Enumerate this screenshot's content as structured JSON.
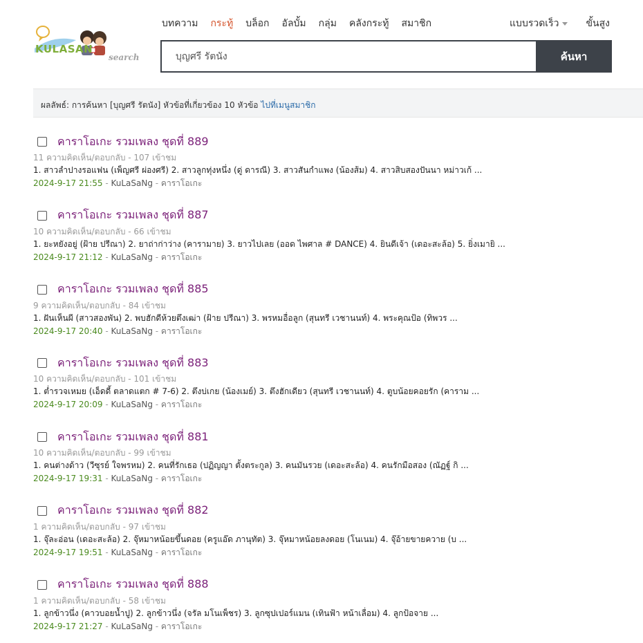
{
  "logo": {
    "wordmark": "KULASAN",
    "suffix": "search"
  },
  "nav": {
    "items": [
      {
        "label": "บทความ",
        "active": false
      },
      {
        "label": "กระทู้",
        "active": true
      },
      {
        "label": "บล็อก",
        "active": false
      },
      {
        "label": "อัลบั้ม",
        "active": false
      },
      {
        "label": "กลุ่ม",
        "active": false
      },
      {
        "label": "คลังกระทู้",
        "active": false
      },
      {
        "label": "สมาชิก",
        "active": false
      }
    ],
    "quick_label": "แบบรวดเร็ว",
    "advanced_label": "ขั้นสูง"
  },
  "search": {
    "value": "บุญศรี รัตนัง",
    "button_label": "ค้นหา"
  },
  "result_summary": {
    "text": "ผลลัพธ์: การค้นหา [บุญศรี รัตนัง] หัวข้อที่เกี่ยวข้อง 10 หัวข้อ",
    "link": "ไปที่เมนูสมาชิก"
  },
  "results": [
    {
      "title": "คาราโอเกะ รวมเพลง ชุดที่ 889",
      "meta": "11 ความคิดเห็น/ตอบกลับ - 107 เข้าชม",
      "snippet": "1. สาวลำปางรอแฟน (เพ็ญศรี ผ่องศรี) 2. สาวลูกทุ่งหนึ่ง (ดู่ ดารณี) 3. สาวสันกำแพง (น้องส้ม) 4. สาวสิบสองปันนา หม่าวเก้ ...",
      "date": "2024-9-17 21:55",
      "author": "KuLaSaNg",
      "category": "คาราโอเกะ"
    },
    {
      "title": "คาราโอเกะ รวมเพลง ชุดที่ 887",
      "meta": "10 ความคิดเห็น/ตอบกลับ - 66 เข้าชม",
      "snippet": "1. ยะหยังอยู่ (ฝ้าย ปรีณา) 2. ยาถ่าก่าว่าง (คารามาย) 3. ยาวไปเลย (ออด ไพศาล # DANCE) 4. ยินดีเจ้า (เดอะสะล้อ) 5. ยิ่งเมายิ ...",
      "date": "2024-9-17 21:12",
      "author": "KuLaSaNg",
      "category": "คาราโอเกะ"
    },
    {
      "title": "คาราโอเกะ รวมเพลง ชุดที่ 885",
      "meta": "9 ความคิดเห็น/ตอบกลับ - 84 เข้าชม",
      "snippet": "1. ฝันเห็นผี (สาวสองพัน) 2. พบฮักดีห้วยตึงเฒ่า (ฝ้าย ปรีณา) 3. พรหมอื่อลูก (สุนทรี เวชานนท์) 4. พระคุณป้อ (ทิพวร ...",
      "date": "2024-9-17 20:40",
      "author": "KuLaSaNg",
      "category": "คาราโอเกะ"
    },
    {
      "title": "คาราโอเกะ รวมเพลง ชุดที่ 883",
      "meta": "10 ความคิดเห็น/ตอบกลับ - 101 เข้าชม",
      "snippet": "1. ต่ำรวจเหมย (เอ็ดดี้ ตลาดแตก # 7-6) 2. ตึงบ่เกย (น้องเมย์) 3. ตึงฮักเดียว (สุนทรี เวชานนท์) 4. ตูบน้อยคอยรัก (คาราม ...",
      "date": "2024-9-17 20:09",
      "author": "KuLaSaNg",
      "category": "คาราโอเกะ"
    },
    {
      "title": "คาราโอเกะ รวมเพลง ชุดที่ 881",
      "meta": "10 ความคิดเห็น/ตอบกลับ - 99 เข้าชม",
      "snippet": "1. คนต่างด้าว (วีซุรย์ ใจพรหม) 2. คนที่รักเธอ (ปฏิญญา ตั้งตระกูล) 3. คนมันรวย (เดอะสะล้อ) 4. คนรักมือสอง (ณัฏฐ์ กิ ...",
      "date": "2024-9-17 19:31",
      "author": "KuLaSaNg",
      "category": "คาราโอเกะ"
    },
    {
      "title": "คาราโอเกะ รวมเพลง ชุดที่ 882",
      "meta": "1 ความคิดเห็น/ตอบกลับ - 97 เข้าชม",
      "snippet": "1. จุ๊ละอ่อน (เดอะสะล้อ) 2. จุ๊หมาหน้อยขึ้นดอย (ครูแอ๊ด ภานุทัต) 3. จุ๊หมาหน้อยลงดอย (โนเนม) 4. จุ๊อ้ายขายควาย (บ ...",
      "date": "2024-9-17 19:51",
      "author": "KuLaSaNg",
      "category": "คาราโอเกะ"
    },
    {
      "title": "คาราโอเกะ รวมเพลง ชุดที่ 888",
      "meta": "1 ความคิดเห็น/ตอบกลับ - 58 เข้าชม",
      "snippet": "1. ลูกข้าวนึ่ง (คาวบอยน้ำปู) 2. ลูกข้าวนึ่ง (จรัล มโนเพ็ชร) 3. ลูกซุปเปอร์แมน (เทินฟ้า หน้าเลื่อม) 4. ลูกป้อจาย ...",
      "date": "2024-9-17 21:27",
      "author": "KuLaSaNg",
      "category": "คาราโอเกะ"
    }
  ],
  "colors": {
    "accent": "#d4522a",
    "title": "#7a1f78",
    "date": "#4a8a1e",
    "dark": "#3d4249",
    "link": "#2a6aa8"
  },
  "separator": " - "
}
